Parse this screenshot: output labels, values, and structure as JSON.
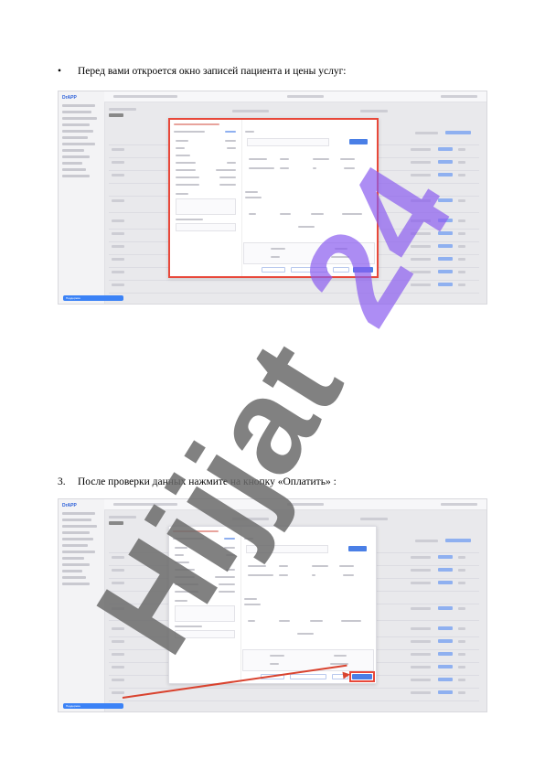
{
  "document": {
    "intro_bullet": "•",
    "intro_text": "Перед вами откроется окно записей пациента и цены услуг:",
    "step_number": "3.",
    "step_text": "После проверки данных нажмите на кнопку «Оплатить» :"
  },
  "watermark": {
    "text": "Hijjat24",
    "colors": {
      "dark": "#6b6b6b",
      "accent": "#8a5cf0"
    }
  },
  "screenshots": {
    "brand_logo_text": "DrAPP",
    "help_button_text": "Поддержка",
    "highlight_color": "#e8483a",
    "accent_color": "#4a7fe6"
  }
}
